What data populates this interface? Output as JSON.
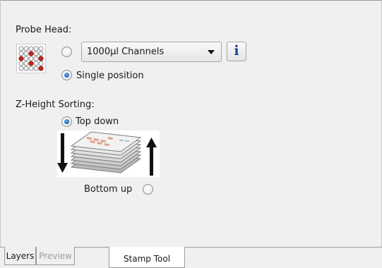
{
  "probe_head": {
    "heading": "Probe Head:",
    "channels_radio_checked": false,
    "channels_select_value": "1000µl Channels",
    "single_position_label": "Single position",
    "single_position_checked": true,
    "info_button_label": "i",
    "plate_icon": "well-plate-icon"
  },
  "z_height": {
    "heading": "Z-Height Sorting:",
    "top_down_label": "Top down",
    "top_down_checked": true,
    "bottom_up_label": "Bottom up",
    "bottom_up_checked": false,
    "image_icon": "plate-stack-sort-icon"
  },
  "tabs": [
    {
      "label": "Layers",
      "state": "normal"
    },
    {
      "label": "Preview",
      "state": "disabled"
    },
    {
      "label": "Stamp Tool",
      "state": "active"
    }
  ],
  "colors": {
    "well_red": "#c8231a",
    "radio_selected": "#1f6fc2",
    "info_icon": "#1c3f9c"
  }
}
